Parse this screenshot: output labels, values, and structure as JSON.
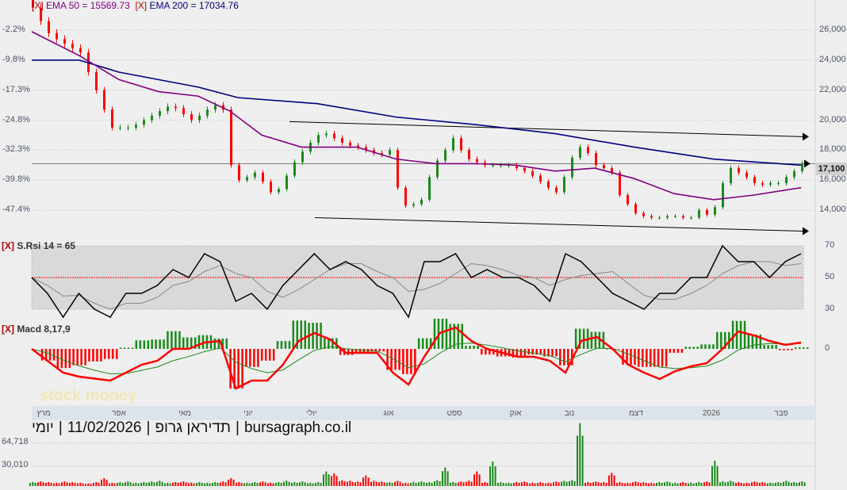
{
  "chart_data": {
    "type": "candlestick",
    "title": "",
    "footer": {
      "period": "יומי",
      "date": "11/02/2026",
      "company": "תדיראן גרופ",
      "site": "bursagraph.co.il"
    },
    "legend": {
      "ema50": "EMA 50 = 15569.73",
      "ema200": "EMA 200 = 17034.76",
      "rsi": "S.Rsi 14 = 65",
      "macd": "Macd 8,17,9",
      "close_marker": "[X]"
    },
    "colors": {
      "up": "#1a8a1a",
      "down": "#ff0000",
      "ema50": "#800080",
      "ema200": "#000080",
      "rsi": "#000000",
      "rsi_mid": "#ff0000",
      "macd": "#ff0000",
      "signal": "#1a8a1a"
    },
    "price_axis": {
      "ticks": [
        "26,000",
        "24,000",
        "22,000",
        "20,000",
        "18,000",
        "16,000",
        "14,000"
      ],
      "values": [
        26000,
        24000,
        22000,
        20000,
        18000,
        16000,
        14000
      ],
      "range": [
        12000,
        27600
      ]
    },
    "pct_axis": [
      "-2.2%",
      "-9.8%",
      "-17.3%",
      "-24.8%",
      "-32.3%",
      "-39.8%",
      "-47.4%"
    ],
    "last_price": "17,100",
    "last_value": 17100,
    "months": [
      "מרץ",
      "אפר",
      "מאי",
      "יוני",
      "יולי",
      "אוג",
      "ספט",
      "אוק",
      "נוב",
      "דצמ",
      "2026",
      "פבר"
    ],
    "closes": [
      27500,
      26600,
      25800,
      25400,
      25100,
      24800,
      24500,
      23200,
      22000,
      20700,
      19500,
      19500,
      19500,
      19700,
      20000,
      20300,
      20600,
      20900,
      20800,
      20400,
      20000,
      20300,
      20700,
      21000,
      20700,
      17000,
      16000,
      16200,
      16500,
      15900,
      15200,
      15400,
      16300,
      17200,
      17900,
      18500,
      19000,
      19100,
      18800,
      18500,
      18300,
      18200,
      18000,
      17800,
      17700,
      18000,
      15500,
      14300,
      14400,
      14700,
      16200,
      17300,
      18000,
      18800,
      18000,
      17400,
      17200,
      17000,
      17000,
      17000,
      17000,
      16800,
      16600,
      16300,
      15900,
      15500,
      15200,
      16200,
      17500,
      18200,
      17800,
      17000,
      16800,
      16500,
      15000,
      14400,
      13800,
      13600,
      13500,
      13500,
      13600,
      13600,
      13500,
      13500,
      14000,
      13700,
      14200,
      15800,
      16800,
      16500,
      16200,
      15800,
      15700,
      15800,
      15800,
      16200,
      16600,
      17100
    ],
    "ema200_points": [
      [
        0,
        24000
      ],
      [
        6,
        24000
      ],
      [
        11,
        23200
      ],
      [
        21,
        22200
      ],
      [
        26,
        21500
      ],
      [
        36,
        21100
      ],
      [
        46,
        20200
      ],
      [
        56,
        19700
      ],
      [
        66,
        19100
      ],
      [
        76,
        18200
      ],
      [
        86,
        17400
      ],
      [
        97,
        17000
      ]
    ],
    "ema50_points": [
      [
        0,
        25900
      ],
      [
        6,
        24300
      ],
      [
        11,
        22700
      ],
      [
        16,
        21900
      ],
      [
        21,
        21600
      ],
      [
        25,
        20600
      ],
      [
        29,
        19000
      ],
      [
        34,
        18200
      ],
      [
        41,
        18200
      ],
      [
        46,
        17400
      ],
      [
        51,
        17100
      ],
      [
        56,
        17100
      ],
      [
        61,
        17000
      ],
      [
        66,
        16600
      ],
      [
        71,
        16800
      ],
      [
        76,
        16100
      ],
      [
        81,
        15100
      ],
      [
        86,
        14700
      ],
      [
        91,
        15000
      ],
      [
        97,
        15500
      ]
    ],
    "trendlines": [
      {
        "from": [
          32.5,
          19900
        ],
        "to": [
          98,
          18900
        ]
      },
      {
        "from": [
          35.7,
          13500
        ],
        "to": [
          98,
          12600
        ]
      }
    ],
    "rsi": {
      "axis": [
        "70",
        "50",
        "30"
      ],
      "values": [
        50,
        40,
        25,
        40,
        30,
        25,
        40,
        40,
        45,
        55,
        50,
        65,
        60,
        35,
        40,
        30,
        45,
        55,
        65,
        55,
        60,
        55,
        45,
        40,
        25,
        60,
        60,
        65,
        50,
        55,
        50,
        50,
        45,
        35,
        65,
        60,
        50,
        40,
        35,
        30,
        40,
        40,
        50,
        50,
        70,
        60,
        60,
        50,
        60,
        65
      ]
    },
    "macd": {
      "axis": [
        "0"
      ],
      "values": [
        0,
        -300,
        -600,
        -700,
        -750,
        -800,
        -600,
        -400,
        -300,
        0,
        0,
        160,
        200,
        -1000,
        -800,
        -800,
        -400,
        200,
        400,
        240,
        -100,
        -100,
        -100,
        -600,
        -900,
        -200,
        400,
        540,
        200,
        0,
        -100,
        -200,
        -200,
        -300,
        -600,
        200,
        300,
        0,
        -400,
        -600,
        -760,
        -560,
        -440,
        -360,
        0,
        440,
        340,
        200,
        100,
        160
      ]
    },
    "volume": {
      "axis": [
        "64,718",
        "30,010"
      ],
      "values": [
        6000,
        7000,
        6000,
        5000,
        7000,
        6000,
        5000,
        4000,
        6000,
        12000,
        5000,
        6000,
        7000,
        5000,
        6000,
        7000,
        8000,
        5000,
        6000,
        7000,
        5000,
        6000,
        5000,
        6000,
        7000,
        12000,
        6000,
        5000,
        6000,
        7000,
        5000,
        6000,
        8000,
        6000,
        7000,
        5000,
        6000,
        22000,
        19000,
        9000,
        8000,
        7000,
        16000,
        8000,
        7000,
        6000,
        8000,
        5000,
        6000,
        7000,
        6000,
        9000,
        28000,
        6000,
        7000,
        8000,
        22000,
        6000,
        37000,
        6000,
        5000,
        6000,
        7000,
        5000,
        6000,
        5000,
        7000,
        8000,
        9000,
        95000,
        6000,
        7000,
        6000,
        20000,
        6000,
        5000,
        7000,
        6000,
        5000,
        6000,
        7000,
        5000,
        6000,
        5000,
        6000,
        7000,
        38000,
        7000,
        8000,
        6000,
        5000,
        7000,
        6000,
        5000,
        6000,
        8000,
        6000,
        7000
      ]
    },
    "watermark": "stock money"
  }
}
